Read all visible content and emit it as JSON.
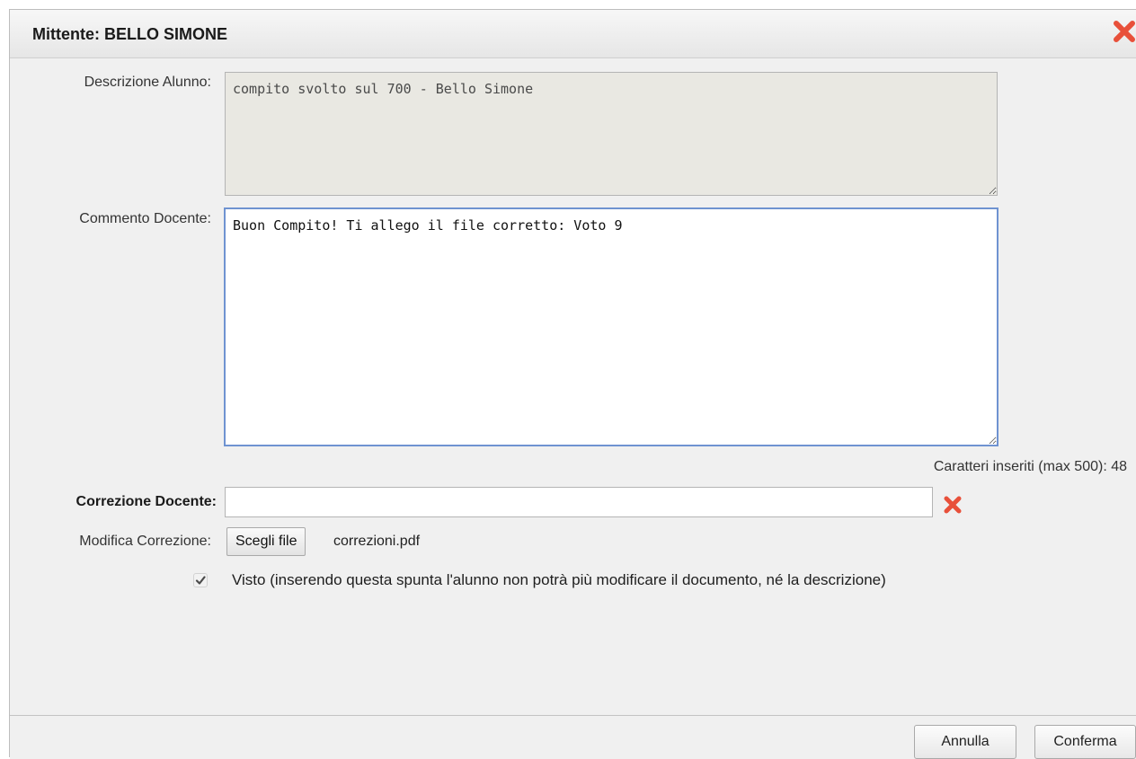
{
  "dialog": {
    "title": "Mittente: BELLO SIMONE",
    "close_icon": "close-x-icon",
    "accent_color": "#e8503a"
  },
  "form": {
    "descrizione_label": "Descrizione Alunno:",
    "descrizione_value": "compito svolto sul 700 - Bello Simone",
    "commento_label": "Commento Docente:",
    "commento_value": "Buon Compito! Ti allego il file corretto: Voto 9",
    "char_count": "Caratteri inseriti (max 500): 48",
    "correzione_label": "Correzione Docente:",
    "correzione_value": "",
    "modifica_label": "Modifica Correzione:",
    "choose_file_button": "Scegli file",
    "selected_file": "correzioni.pdf",
    "visto_checked": true,
    "visto_label": "Visto (inserendo questa spunta l'alunno non potrà più modificare il documento, né la descrizione)"
  },
  "footer": {
    "cancel_label": "Annulla",
    "confirm_label": "Conferma"
  }
}
